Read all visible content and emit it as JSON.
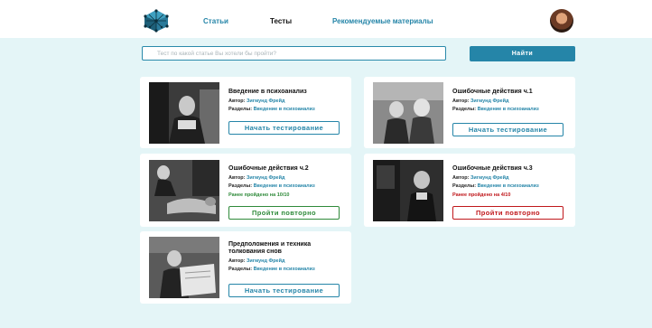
{
  "nav": {
    "links": [
      "Статьи",
      "Тесты",
      "Рекомендуемые материалы"
    ],
    "active": "Тесты"
  },
  "search": {
    "placeholder": "Тест по какой статье Вы хотели бы пройти?",
    "button_label": "Найти"
  },
  "labels": {
    "author": "Автор: ",
    "sections": "Разделы: "
  },
  "cards": [
    {
      "title": "Введение в психоанализ",
      "author": "Зигмунд Фрейд",
      "sections": "Введение в психоанализ",
      "status": "",
      "action": "Начать тестирование",
      "action_style": "blue"
    },
    {
      "title": "Ошибочные действия ч.1",
      "author": "Зигмунд Фрейд",
      "sections": "Введение в психоанализ",
      "status": "",
      "action": "Начать тестирование",
      "action_style": "blue"
    },
    {
      "title": "Ошибочные действия ч.2",
      "author": "Зигмунд Фрейд",
      "sections": "Введение в психоанализ",
      "status": "Ранее пройдено на 10/10",
      "action": "Пройти повторно",
      "action_style": "green"
    },
    {
      "title": "Ошибочные действия ч.3",
      "author": "Зигмунд Фрейд",
      "sections": "Введение в психоанализ",
      "status": "Ранее пройдено на 4/10",
      "action": "Пройти повторно",
      "action_style": "red"
    },
    {
      "title": "Предположения  и техника толкования снов",
      "author": "Зигмунд Фрейд",
      "sections": "Введение в психоанализ",
      "status": "",
      "action": "Начать тестирование",
      "action_style": "blue"
    }
  ],
  "colors": {
    "accent": "#2585a8",
    "background": "#e4f5f7",
    "success": "#2f8a3a",
    "danger": "#c0181c"
  }
}
